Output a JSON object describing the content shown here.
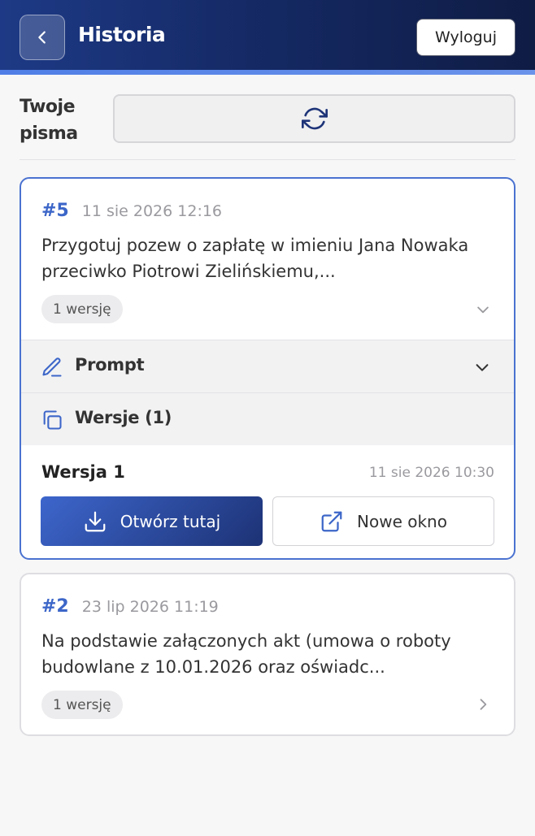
{
  "header": {
    "title": "Historia",
    "logout_label": "Wyloguj",
    "back_icon": "chevron-left-icon"
  },
  "section": {
    "title": "Twoje pisma",
    "refresh_icon": "refresh-icon"
  },
  "documents": [
    {
      "number": "#5",
      "date": "11 sie 2026 12:16",
      "text": "Przygotuj pozew o zapłatę w imieniu Jana Nowaka przeciwko Piotrowi Zielińskiemu,...",
      "versions_badge": "1 wersję",
      "expanded": true,
      "prompt_label": "Prompt",
      "versions_label": "Wersje (1)",
      "version": {
        "title": "Wersja 1",
        "date": "11 sie 2026 10:30",
        "open_here_label": "Otwórz tutaj",
        "new_window_label": "Nowe okno"
      }
    },
    {
      "number": "#2",
      "date": "23 lip 2026 11:19",
      "text": "Na podstawie załączonych akt (umowa o roboty budowlane z 10.01.2026 oraz oświadc...",
      "versions_badge": "1 wersję",
      "expanded": false
    }
  ],
  "colors": {
    "accent": "#3c66c8",
    "header_dark": "#0f1c44",
    "header_blue": "#1e3a86"
  }
}
